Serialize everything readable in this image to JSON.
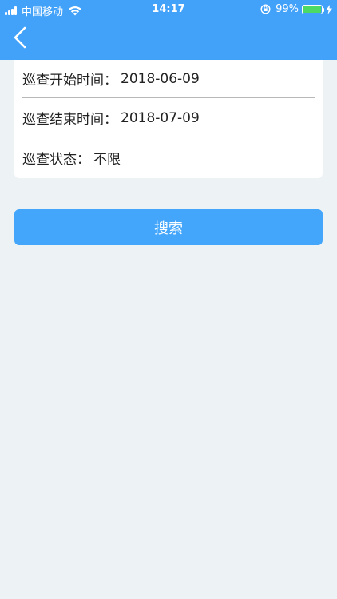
{
  "status_bar": {
    "carrier": "中国移动",
    "time": "14:17",
    "battery_percent": "99%",
    "battery_level": 0.99,
    "battery_color": "#4cd964"
  },
  "header": {
    "back_icon": "chevron-left-icon",
    "color": "#42a2f9"
  },
  "form": {
    "start_time": {
      "label": "巡查开始时间：",
      "value": "2018-06-09"
    },
    "end_time": {
      "label": "巡查结束时间：",
      "value": "2018-07-09"
    },
    "status": {
      "label": "巡查状态：",
      "value": "不限"
    }
  },
  "search_button": {
    "label": "搜索",
    "color": "#43a6fb"
  }
}
